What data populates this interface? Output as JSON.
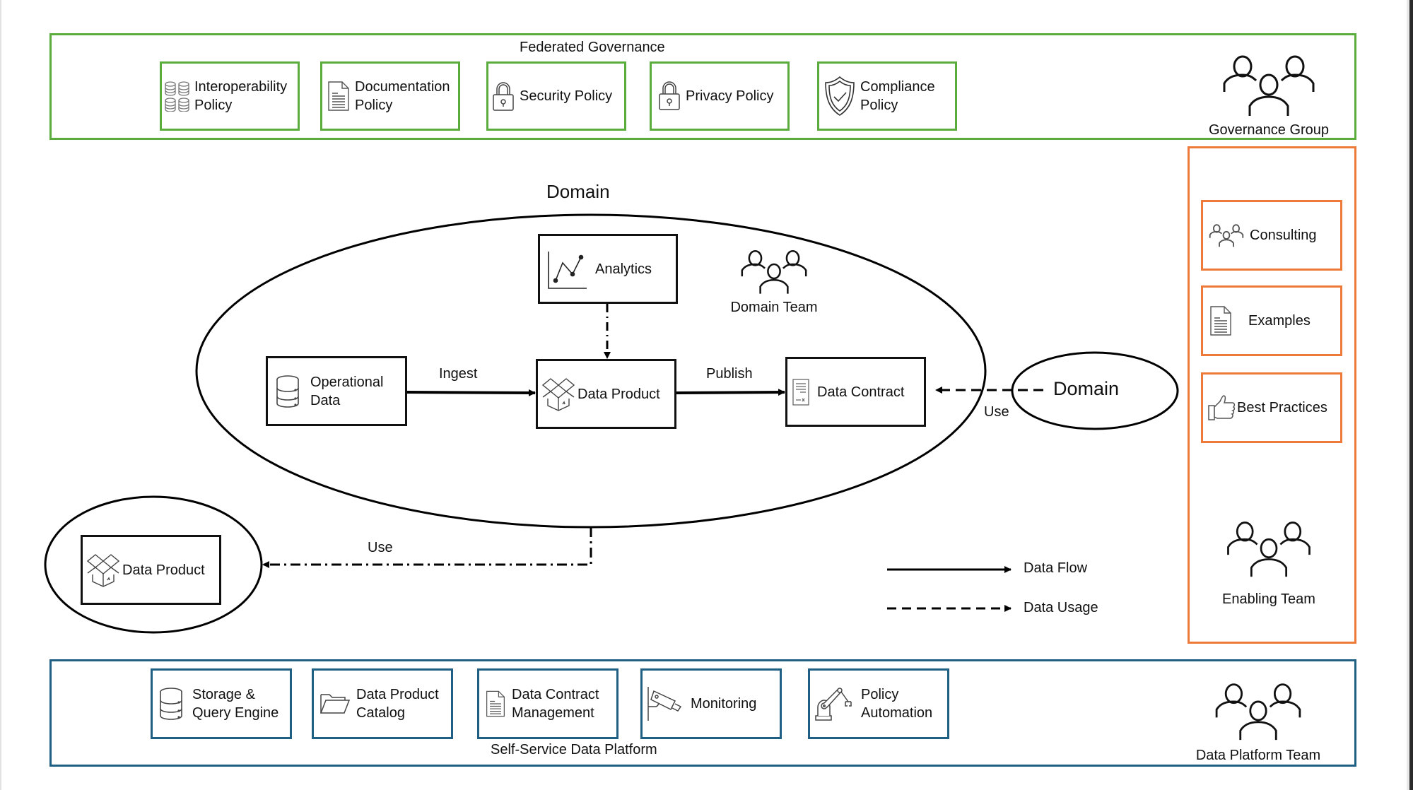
{
  "governance": {
    "title": "Federated Governance",
    "colors": {
      "border": "#5aad3c"
    },
    "policies": [
      {
        "label": "Interoperability\nPolicy",
        "icon": "database-grid-icon"
      },
      {
        "label": "Documentation\nPolicy",
        "icon": "document-icon"
      },
      {
        "label": "Security Policy",
        "icon": "padlock-icon"
      },
      {
        "label": "Privacy Policy",
        "icon": "padlock-icon"
      },
      {
        "label": "Compliance\nPolicy",
        "icon": "shield-check-icon"
      }
    ],
    "team": {
      "label": "Governance Group",
      "icon": "people-group-icon"
    }
  },
  "domain": {
    "title": "Domain",
    "nodes": {
      "analytics": {
        "label": "Analytics",
        "icon": "line-chart-icon"
      },
      "operational_data": {
        "label": "Operational\nData",
        "icon": "database-icon"
      },
      "data_product": {
        "label": "Data Product",
        "icon": "open-box-icon"
      },
      "data_contract": {
        "label": "Data Contract",
        "icon": "contract-document-icon"
      }
    },
    "edges": {
      "ingest": "Ingest",
      "publish": "Publish",
      "use_right": "Use",
      "use_left": "Use"
    },
    "team": {
      "label": "Domain Team",
      "icon": "people-group-icon"
    }
  },
  "external_domain": {
    "label": "Domain"
  },
  "external_data_product": {
    "label": "Data Product",
    "icon": "open-box-icon"
  },
  "enabling": {
    "colors": {
      "border": "#ee7a3a"
    },
    "items": [
      {
        "label": "Consulting",
        "icon": "people-group-icon"
      },
      {
        "label": "Examples",
        "icon": "document-icon"
      },
      {
        "label": "Best Practices",
        "icon": "thumbs-up-icon"
      }
    ],
    "team": {
      "label": "Enabling Team",
      "icon": "people-group-icon"
    }
  },
  "legend": {
    "items": [
      {
        "label": "Data Flow",
        "style": "solid"
      },
      {
        "label": "Data Usage",
        "style": "dashed"
      }
    ]
  },
  "platform": {
    "title": "Self-Service Data Platform",
    "colors": {
      "border": "#1f5f84"
    },
    "items": [
      {
        "label": "Storage &\nQuery Engine",
        "icon": "database-icon"
      },
      {
        "label": "Data Product\nCatalog",
        "icon": "folder-icon"
      },
      {
        "label": "Data Contract\nManagement",
        "icon": "document-icon"
      },
      {
        "label": "Monitoring",
        "icon": "security-camera-icon"
      },
      {
        "label": "Policy\nAutomation",
        "icon": "robot-arm-icon"
      }
    ],
    "team": {
      "label": "Data Platform Team",
      "icon": "people-group-icon"
    }
  }
}
